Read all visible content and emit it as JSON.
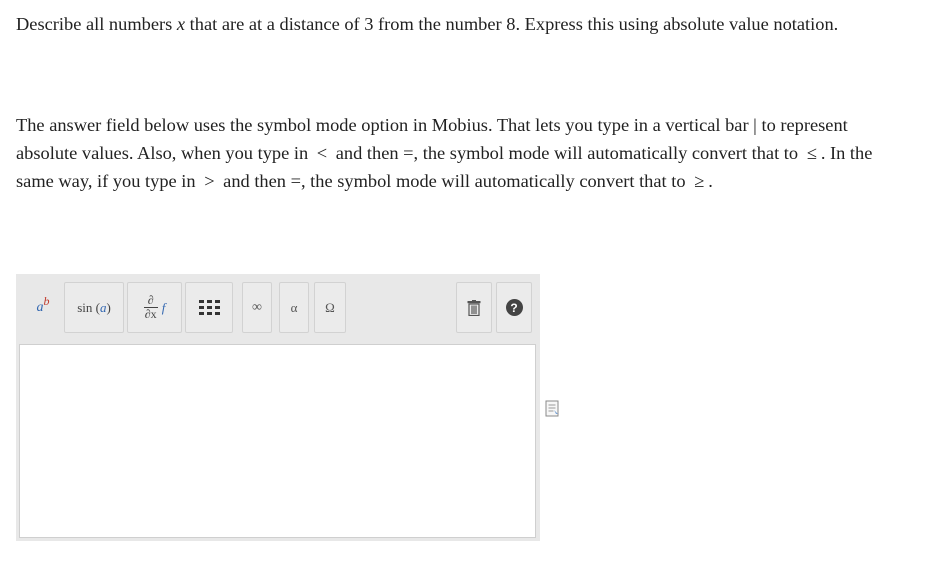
{
  "question": {
    "q1_a": "Describe all numbers ",
    "q1_var": "x",
    "q1_b": " that are at a distance of 3 from the number 8. Express this using absolute value notation."
  },
  "instructions": {
    "p1": "The answer field below uses the symbol mode option in Mobius. That lets you type in a vertical bar | to represent absolute values. Also, when you type in ",
    "lt": "<",
    "p2": " and then =, the symbol mode will automatically convert that to ",
    "le": "≤",
    "p3": ". In the same way, if you type in ",
    "gt": ">",
    "p4": " and then =, the symbol mode will automatically convert that to ",
    "ge": "≥",
    "p5": "."
  },
  "toolbar": {
    "power_base": "a",
    "power_exp": "b",
    "sin_fn": "sin",
    "sin_arg": "a",
    "deriv_num": "∂",
    "deriv_den": "∂x",
    "deriv_f": "f",
    "infinity": "∞",
    "alpha": "α",
    "omega": "Ω",
    "help": "?"
  },
  "answer_field": {
    "value": ""
  },
  "colors": {
    "toolbar_bg": "#e8e8e8",
    "accent_blue": "#3367b0",
    "accent_red": "#c0392b"
  }
}
